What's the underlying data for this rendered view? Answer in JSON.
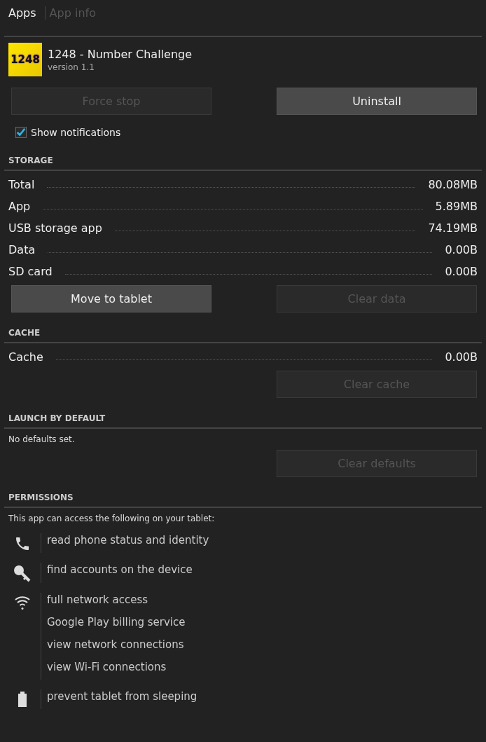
{
  "breadcrumb": [
    {
      "label": "Apps",
      "selected": true
    },
    {
      "label": "App info",
      "selected": false
    }
  ],
  "app": {
    "icon_text": "1248",
    "name": "1248 - Number Challenge",
    "version": "version 1.1"
  },
  "app_buttons": [
    {
      "label": "Force stop",
      "disabled": true
    },
    {
      "label": "Uninstall",
      "disabled": false
    }
  ],
  "show_notifications": {
    "label": "Show notifications",
    "checked": true
  },
  "storage": {
    "title": "STORAGE",
    "rows": [
      {
        "label": "Total",
        "value": "80.08MB"
      },
      {
        "label": "App",
        "value": "5.89MB"
      },
      {
        "label": "USB storage app",
        "value": "74.19MB"
      },
      {
        "label": "Data",
        "value": "0.00B"
      },
      {
        "label": "SD card",
        "value": "0.00B"
      }
    ],
    "buttons": [
      {
        "label": "Move to tablet",
        "disabled": false
      },
      {
        "label": "Clear data",
        "disabled": true
      }
    ]
  },
  "cache": {
    "title": "CACHE",
    "rows": [
      {
        "label": "Cache",
        "value": "0.00B"
      }
    ],
    "buttons": [
      {
        "label": "Clear cache",
        "disabled": true
      }
    ]
  },
  "launch_by_default": {
    "title": "LAUNCH BY DEFAULT",
    "note": "No defaults set.",
    "buttons": [
      {
        "label": "Clear defaults",
        "disabled": true
      }
    ]
  },
  "permissions": {
    "title": "PERMISSIONS",
    "intro": "This app can access the following on your tablet:",
    "groups": [
      {
        "kind": "phone",
        "items": [
          "read phone status and identity"
        ]
      },
      {
        "kind": "key",
        "items": [
          "find accounts on the device"
        ]
      },
      {
        "kind": "wifi",
        "items": [
          "full network access",
          "Google Play billing service",
          "view network connections",
          "view Wi-Fi connections"
        ]
      },
      {
        "kind": "battery",
        "items": [
          "prevent tablet from sleeping"
        ]
      }
    ]
  }
}
